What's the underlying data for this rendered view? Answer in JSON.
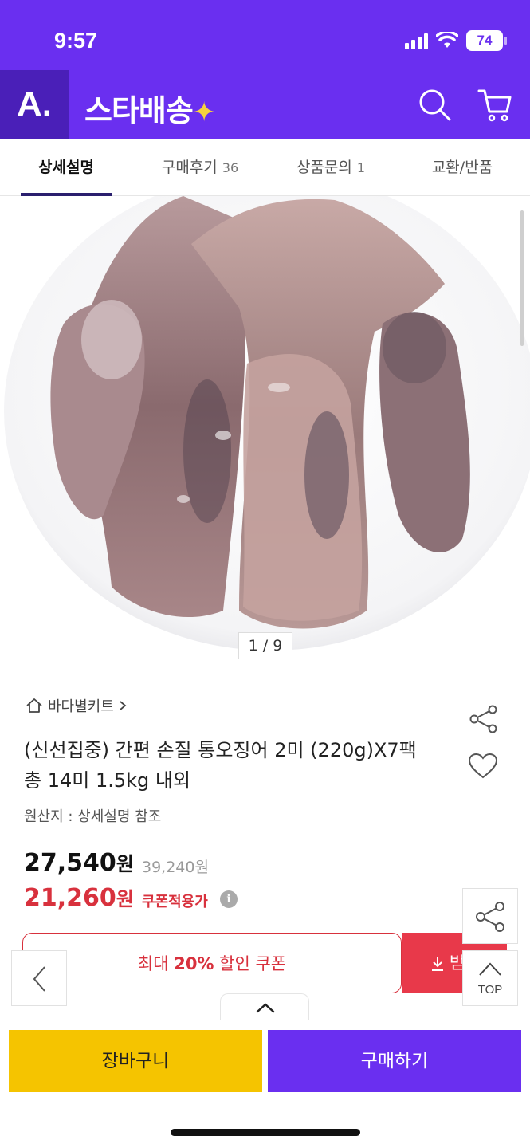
{
  "status": {
    "time": "9:57",
    "battery": "74"
  },
  "header": {
    "logo": "A.",
    "brand": "스타배송",
    "brand_spark": "✦"
  },
  "tabs": [
    {
      "label": "상세설명",
      "count": ""
    },
    {
      "label": "구매후기",
      "count": "36"
    },
    {
      "label": "상품문의",
      "count": "1"
    },
    {
      "label": "교환/반품",
      "count": ""
    }
  ],
  "gallery": {
    "counter": "1 / 9"
  },
  "product": {
    "seller": "바다별키트",
    "title": "(신선집중) 간편 손질 통오징어 2미 (220g)X7팩 총 14미 1.5kg 내외",
    "origin": "원산지 : 상세설명 참조",
    "price": "27,540",
    "price_unit": "원",
    "original_price": "39,240원",
    "coupon_price": "21,260",
    "coupon_price_unit": "원",
    "coupon_label": "쿠폰적용가"
  },
  "coupon": {
    "prefix": "최대 ",
    "percent": "20%",
    "suffix": " 할인 쿠폰",
    "download_label": "받기"
  },
  "floating": {
    "top_label": "TOP"
  },
  "bottom": {
    "cart_label": "장바구니",
    "buy_label": "구매하기"
  },
  "colors": {
    "brand": "#6a2ff0",
    "accent_red": "#d8313d",
    "cart_yellow": "#f5c400"
  }
}
